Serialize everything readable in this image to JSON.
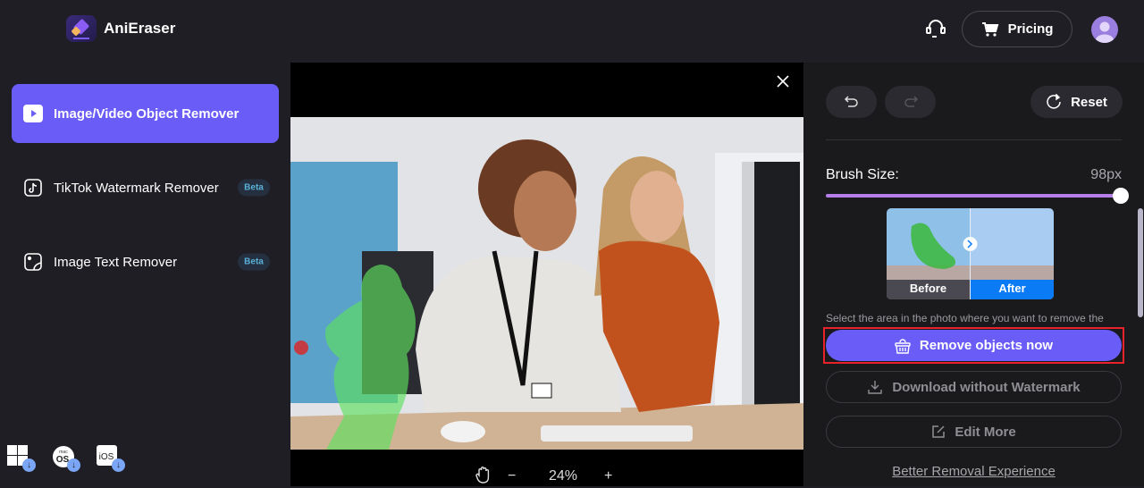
{
  "app": {
    "title": "AniEraser"
  },
  "header": {
    "pricing_label": "Pricing",
    "support_icon": "headset-icon",
    "cart_icon": "cart-icon",
    "avatar_icon": "user-avatar-icon"
  },
  "sidebar": {
    "items": [
      {
        "label": "Image/Video Object Remover",
        "icon": "play-icon",
        "active": true,
        "badge": ""
      },
      {
        "label": "TikTok Watermark Remover",
        "icon": "tiktok-icon",
        "active": false,
        "badge": "Beta"
      },
      {
        "label": "Image Text Remover",
        "icon": "image-icon",
        "active": false,
        "badge": "Beta"
      }
    ],
    "platforms": [
      {
        "name": "windows-download-icon",
        "label": ""
      },
      {
        "name": "macos-download-icon",
        "label": "mac OS"
      },
      {
        "name": "ios-download-icon",
        "label": "iOS"
      }
    ]
  },
  "canvas": {
    "zoom_level": "24%",
    "zoom_out": "−",
    "zoom_in": "+"
  },
  "panel": {
    "reset_label": "Reset",
    "brush_label": "Brush Size:",
    "brush_value": "98px",
    "brush_fraction": 1.0,
    "before_label": "Before",
    "after_label": "After",
    "hint": "Select the area in the photo where you want to remove the",
    "remove_label": "Remove objects now",
    "download_label": "Download without Watermark",
    "edit_label": "Edit More",
    "link_label": "Better Removal Experience"
  },
  "colors": {
    "accent": "#6a5cf6",
    "slider": "#b57ee9",
    "highlight": "#e8222a",
    "after": "#0a7af5"
  }
}
